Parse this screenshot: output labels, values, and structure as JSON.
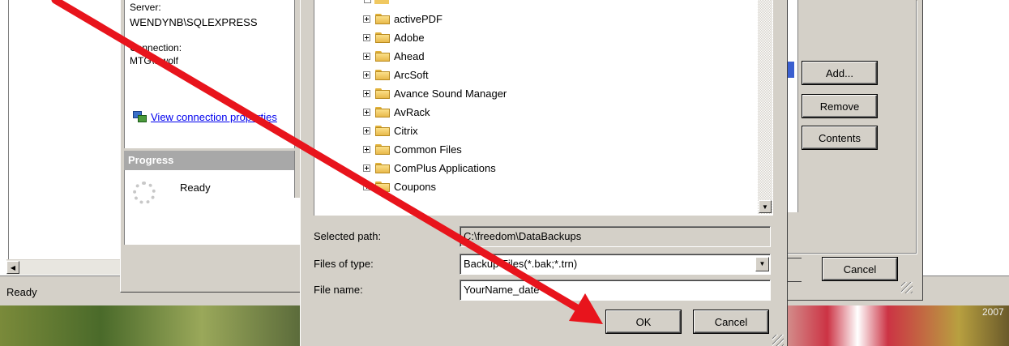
{
  "left_panel": {
    "server_label": "Server:",
    "server_value": "WENDYNB\\SQLEXPRESS",
    "connection_label": "Connection:",
    "connection_value": "MTG\\wwolf",
    "view_connection_link": "View connection properties",
    "progress_header": "Progress",
    "progress_status": "Ready"
  },
  "status_bar": {
    "text": "Ready"
  },
  "file_tree": {
    "items": [
      {
        "label": "activePDF"
      },
      {
        "label": "Adobe"
      },
      {
        "label": "Ahead"
      },
      {
        "label": "ArcSoft"
      },
      {
        "label": "Avance Sound Manager"
      },
      {
        "label": "AvRack"
      },
      {
        "label": "Citrix"
      },
      {
        "label": "Common Files"
      },
      {
        "label": "ComPlus Applications"
      },
      {
        "label": "Coupons"
      }
    ]
  },
  "locate_dialog": {
    "selected_path_label": "Selected path:",
    "selected_path_value": "C:\\freedom\\DataBackups",
    "files_of_type_label": "Files of type:",
    "files_of_type_value": "Backup Files(*.bak;*.trn)",
    "file_name_label": "File name:",
    "file_name_value": "YourName_date",
    "ok_label": "OK",
    "cancel_label": "Cancel"
  },
  "right_buttons": {
    "add_label": "Add...",
    "remove_label": "Remove",
    "contents_label": "Contents",
    "cancel_label": "Cancel"
  },
  "background": {
    "year_text": "2007"
  },
  "colors": {
    "arrow": "#e8141c",
    "link": "#0000ee",
    "progress_header_bg": "#a8a8a8",
    "dialog_face": "#d4d0c8"
  }
}
